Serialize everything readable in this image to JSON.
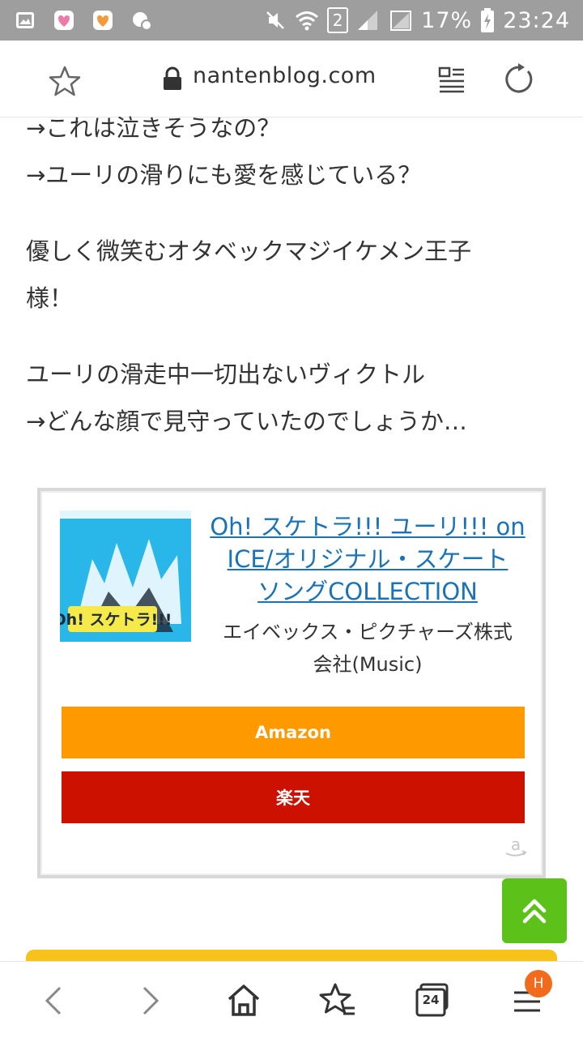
{
  "status_bar": {
    "sim": "2",
    "battery": "17%",
    "time": "23:24"
  },
  "address_bar": {
    "url": "nantenblog.com"
  },
  "article": {
    "lines": [
      "→これは泣きそうなの？",
      "→ユーリの滑りにも愛を感じている？",
      "優しく微笑むオタベックマジイケメン王子",
      "様！",
      "ユーリの滑走中一切出ないヴィクトル",
      "→どんな顔で見守っていたのでしょうか…"
    ]
  },
  "product": {
    "title_lines": [
      "Oh! スケトラ!!! ユーリ!!! on",
      "ICE/オリジナル・スケート",
      "ソングCOLLECTION"
    ],
    "maker_lines": [
      "エイベックス・ピクチャーズ株式",
      "会社(Music)"
    ],
    "album_text": "Oh! スケトラ!!!",
    "amazon_label": "Amazon",
    "rakuten_label": "楽天"
  },
  "bottom_nav": {
    "tab_count": "24",
    "menu_badge": "H"
  },
  "colors": {
    "status_bar": "#9e9e9e",
    "link": "#1a73b8",
    "amazon": "#ff9900",
    "rakuten": "#cc1100",
    "to_top": "#5cc21a",
    "badge": "#f26a1b"
  }
}
